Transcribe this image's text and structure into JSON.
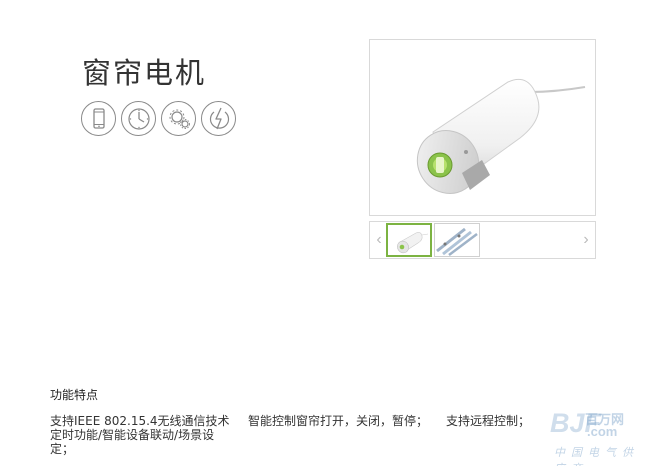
{
  "product": {
    "title": "窗帘电机"
  },
  "feature_icons": [
    "smartphone-icon",
    "clock-icon",
    "scene-gears-icon",
    "power-bolt-icon"
  ],
  "gallery": {
    "prev_arrow": "‹",
    "next_arrow": "›",
    "thumbnails": [
      "curtain-motor-thumbnail",
      "curtain-rail-thumbnail"
    ],
    "active_index": 0
  },
  "features_section": {
    "title": "功能特点",
    "items": [
      "支持IEEE 802.15.4无线通信技术定时功能/智能设备联动/场景设定；",
      "智能控制窗帘打开，关闭，暂停；",
      "支持远程控制；"
    ]
  },
  "watermark": {
    "brand": "BJF",
    "cn_text": "百万网",
    "domain": ".com",
    "subtitle": "中国电气供应商"
  },
  "colors": {
    "accent_green": "#7cb342",
    "icon_gray": "#8a8a8a",
    "border_gray": "#d9d9d9"
  }
}
